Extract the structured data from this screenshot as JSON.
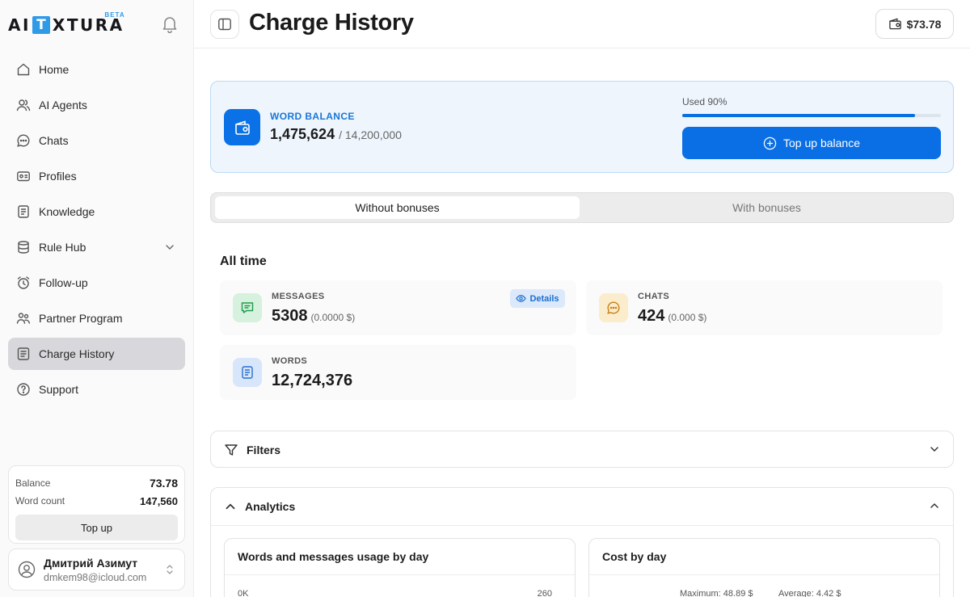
{
  "app": {
    "logo_text_left": "AI",
    "logo_box_letter": "T",
    "logo_text_right": "XTURA",
    "logo_badge": "BETA"
  },
  "sidebar": {
    "items": [
      {
        "label": "Home",
        "icon": "home-icon"
      },
      {
        "label": "AI Agents",
        "icon": "users-icon"
      },
      {
        "label": "Chats",
        "icon": "chat-icon"
      },
      {
        "label": "Profiles",
        "icon": "id-card-icon"
      },
      {
        "label": "Knowledge",
        "icon": "document-icon"
      },
      {
        "label": "Rule Hub",
        "icon": "database-icon"
      },
      {
        "label": "Follow-up",
        "icon": "alarm-clock-icon"
      },
      {
        "label": "Partner Program",
        "icon": "partners-icon"
      },
      {
        "label": "Charge History",
        "icon": "receipt-icon",
        "active": true
      },
      {
        "label": "Support",
        "icon": "help-icon"
      }
    ],
    "balance": {
      "balance_label": "Balance",
      "balance_value": "73.78",
      "word_count_label": "Word count",
      "word_count_value": "147,560",
      "top_up_label": "Top up"
    },
    "user": {
      "name": "Дмитрий Азимут",
      "email": "dmkem98@icloud.com"
    }
  },
  "header": {
    "title": "Charge History",
    "wallet_amount": "$73.78"
  },
  "word_balance": {
    "label": "WORD BALANCE",
    "current": "1,475,624",
    "total": "/ 14,200,000",
    "used_label": "Used 90%",
    "used_fraction": 0.9,
    "top_up_label": "Top up balance"
  },
  "tabs": {
    "without_bonuses": "Without bonuses",
    "with_bonuses": "With bonuses",
    "active": "without_bonuses"
  },
  "all_time": {
    "title": "All time",
    "messages": {
      "label": "MESSAGES",
      "value": "5308",
      "sub": "(0.0000 $)",
      "details_label": "Details"
    },
    "chats": {
      "label": "CHATS",
      "value": "424",
      "sub": "(0.000 $)"
    },
    "words": {
      "label": "WORDS",
      "value": "12,724,376"
    }
  },
  "filters": {
    "title": "Filters"
  },
  "analytics": {
    "title": "Analytics",
    "usage_chart": {
      "title": "Words and messages usage by day",
      "tick_left": "0K",
      "tick_right": "260"
    },
    "cost_chart": {
      "title": "Cost by day",
      "maximum": "Maximum: 48.89 $",
      "average": "Average: 4.42 $"
    }
  },
  "colors": {
    "accent": "#0a6fe4",
    "logo_blue": "#2f9ae8",
    "active_nav": "#d8d8dc",
    "balance_card_bg": "#eef5fd"
  }
}
